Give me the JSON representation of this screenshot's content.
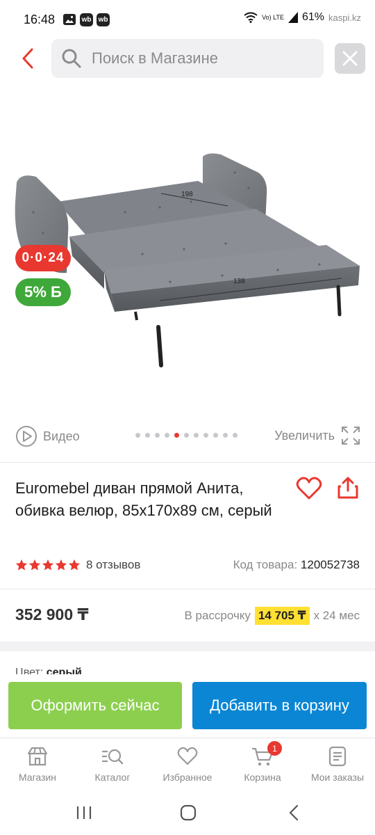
{
  "status_bar": {
    "time": "16:48",
    "badge1": "wb",
    "badge2": "wb",
    "network": "Vo) LTE",
    "battery": "61%",
    "brand": "kaspi.kz"
  },
  "header": {
    "search_placeholder": "Поиск в Магазине"
  },
  "product": {
    "badges": {
      "installment": "0·0·24",
      "bonus": "5% Б"
    },
    "media": {
      "video_label": "Видео",
      "zoom_label": "Увеличить",
      "gallery_total": 11,
      "gallery_active": 4
    },
    "image_dimensions": {
      "length": "198",
      "width": "138"
    },
    "title": "Euromebel диван прямой Анита, обивка велюр, 85x170x89 см, серый",
    "rating": 5,
    "reviews": "8 отзывов",
    "sku_label": "Код товара:",
    "sku": "120052738",
    "price": "352 900 ₸",
    "installment_label": "В рассрочку",
    "installment_amount": "14 705 ₸",
    "installment_term": "x 24 мес",
    "color_label": "Цвет:",
    "color_value": "серый"
  },
  "actions": {
    "checkout": "Оформить сейчас",
    "add_to_cart": "Добавить в корзину"
  },
  "bottom_nav": {
    "items": [
      {
        "label": "Магазин",
        "icon": "shop-icon"
      },
      {
        "label": "Каталог",
        "icon": "catalog-search-icon"
      },
      {
        "label": "Избранное",
        "icon": "heart-icon"
      },
      {
        "label": "Корзина",
        "icon": "cart-icon",
        "badge": "1"
      },
      {
        "label": "Мои заказы",
        "icon": "orders-icon"
      }
    ]
  },
  "colors": {
    "accent_red": "#e8382f",
    "checkout_green": "#8ccf4f",
    "cart_blue": "#0a86d4",
    "installment_yellow": "#ffe033",
    "bonus_green": "#3fa83a"
  }
}
